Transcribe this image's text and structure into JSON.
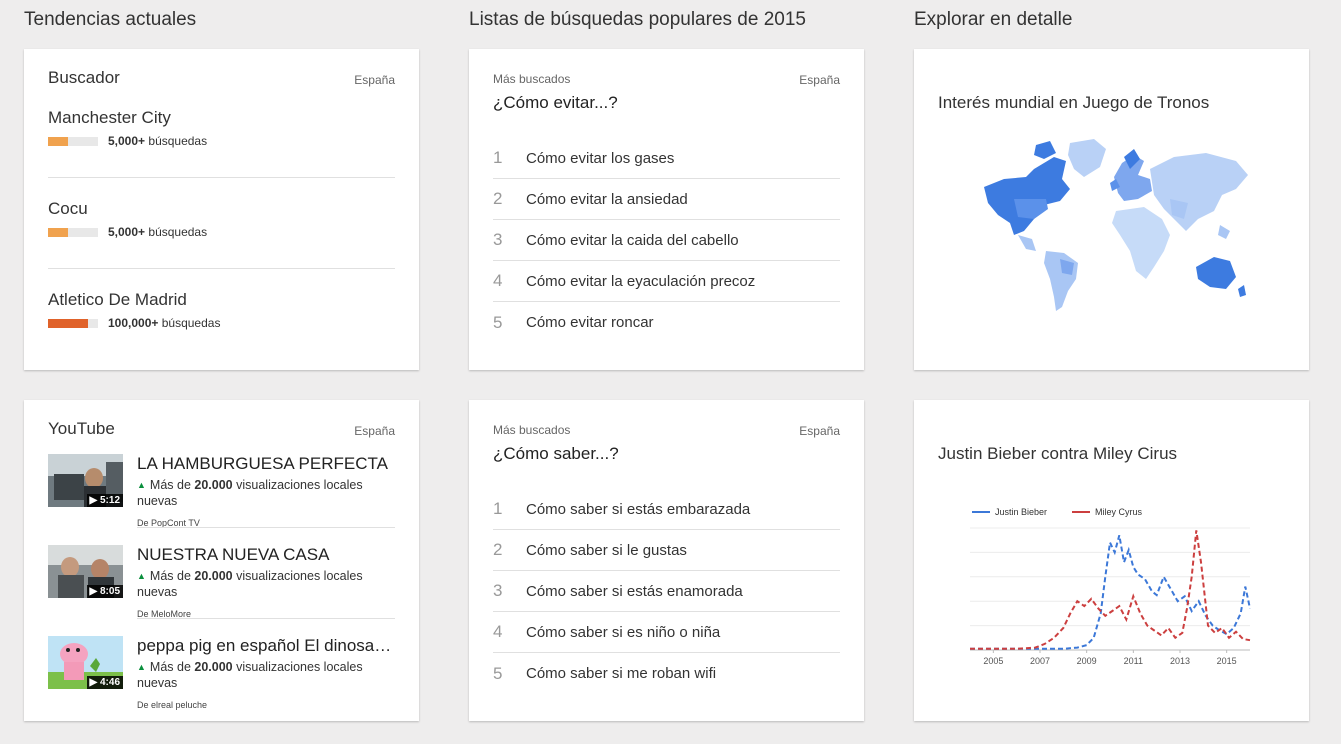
{
  "columns": {
    "trending": "Tendencias actuales",
    "lists": "Listas de búsquedas populares de 2015",
    "explore": "Explorar en detalle"
  },
  "search_card": {
    "title": "Buscador",
    "region": "España",
    "suffix": "búsquedas",
    "items": [
      {
        "name": "Manchester City",
        "count": "5,000+",
        "level": 0.4,
        "color": "#f0a24e"
      },
      {
        "name": "Cocu",
        "count": "5,000+",
        "level": 0.4,
        "color": "#f0a24e"
      },
      {
        "name": "Atletico De Madrid",
        "count": "100,000+",
        "level": 0.8,
        "color": "#e0622a"
      }
    ]
  },
  "list1": {
    "label": "Más buscados",
    "region": "España",
    "title": "¿Cómo evitar...?",
    "items": [
      {
        "n": "1",
        "text": "Cómo evitar los gases"
      },
      {
        "n": "2",
        "text": "Cómo evitar la ansiedad"
      },
      {
        "n": "3",
        "text": "Cómo evitar la caida del cabello"
      },
      {
        "n": "4",
        "text": "Cómo evitar la eyaculación precoz"
      },
      {
        "n": "5",
        "text": "Cómo evitar roncar"
      }
    ]
  },
  "list2": {
    "label": "Más buscados",
    "region": "España",
    "title": "¿Cómo saber...?",
    "items": [
      {
        "n": "1",
        "text": "Cómo saber si estás embarazada"
      },
      {
        "n": "2",
        "text": "Cómo saber si le gustas"
      },
      {
        "n": "3",
        "text": "Cómo saber si estás enamorada"
      },
      {
        "n": "4",
        "text": "Cómo saber si es niño o niña"
      },
      {
        "n": "5",
        "text": "Cómo saber si me roban wifi"
      }
    ]
  },
  "map_card": {
    "title": "Interés mundial en Juego de Tronos"
  },
  "youtube_card": {
    "title": "YouTube",
    "region": "España",
    "views_prefix": "Más de",
    "views_count": "20.000",
    "views_suffix": "visualizaciones locales nuevas",
    "items": [
      {
        "title": "LA HAMBURGUESA PERFECTA",
        "duration": "5:12",
        "channel": "De PopCont TV",
        "thumb_icon": "car-scene-thumbnail"
      },
      {
        "title": "NUESTRA NUEVA CASA",
        "duration": "8:05",
        "channel": "De MeloMore",
        "thumb_icon": "people-thumbnail"
      },
      {
        "title": "peppa pig en español El dinosaurio",
        "duration": "4:46",
        "channel": "De elreal peluche",
        "thumb_icon": "cartoon-pig-thumbnail"
      }
    ]
  },
  "compare_card": {
    "title": "Justin Bieber contra Miley Cirus"
  },
  "chart_data": {
    "type": "line",
    "title": "Justin Bieber contra Miley Cirus",
    "xlabel": "",
    "ylabel": "",
    "x_ticks": [
      "2005",
      "2007",
      "2009",
      "2011",
      "2013",
      "2015"
    ],
    "xlim": [
      2004.0,
      2016.0
    ],
    "ylim": [
      0,
      100
    ],
    "grid": true,
    "legend": "top-left",
    "series": [
      {
        "name": "Justin Bieber",
        "color": "#3c78d8",
        "dash": true,
        "x": [
          2004.0,
          2005.0,
          2006.0,
          2007.0,
          2008.0,
          2008.6,
          2009.0,
          2009.3,
          2009.6,
          2009.8,
          2010.0,
          2010.2,
          2010.4,
          2010.6,
          2010.8,
          2011.0,
          2011.2,
          2011.5,
          2011.8,
          2012.0,
          2012.3,
          2012.6,
          2012.9,
          2013.2,
          2013.5,
          2013.8,
          2014.1,
          2014.4,
          2014.7,
          2015.0,
          2015.3,
          2015.6,
          2015.8,
          2016.0
        ],
        "y": [
          1,
          1,
          1,
          1,
          1,
          2,
          4,
          10,
          30,
          60,
          88,
          80,
          94,
          72,
          82,
          68,
          62,
          58,
          48,
          45,
          60,
          50,
          40,
          44,
          32,
          40,
          28,
          20,
          16,
          13,
          18,
          30,
          52,
          34
        ]
      },
      {
        "name": "Miley Cyrus",
        "color": "#cc3f3f",
        "dash": true,
        "x": [
          2004.0,
          2005.0,
          2006.0,
          2006.8,
          2007.2,
          2007.6,
          2008.0,
          2008.3,
          2008.6,
          2008.9,
          2009.2,
          2009.5,
          2009.8,
          2010.1,
          2010.4,
          2010.7,
          2011.0,
          2011.3,
          2011.6,
          2011.9,
          2012.2,
          2012.5,
          2012.8,
          2013.1,
          2013.3,
          2013.5,
          2013.7,
          2013.9,
          2014.2,
          2014.5,
          2014.8,
          2015.1,
          2015.4,
          2015.7,
          2016.0
        ],
        "y": [
          1,
          1,
          1,
          2,
          5,
          10,
          18,
          30,
          40,
          36,
          42,
          34,
          28,
          32,
          36,
          25,
          44,
          30,
          20,
          16,
          12,
          18,
          10,
          14,
          34,
          60,
          98,
          72,
          20,
          14,
          18,
          10,
          15,
          9,
          8
        ]
      }
    ]
  }
}
